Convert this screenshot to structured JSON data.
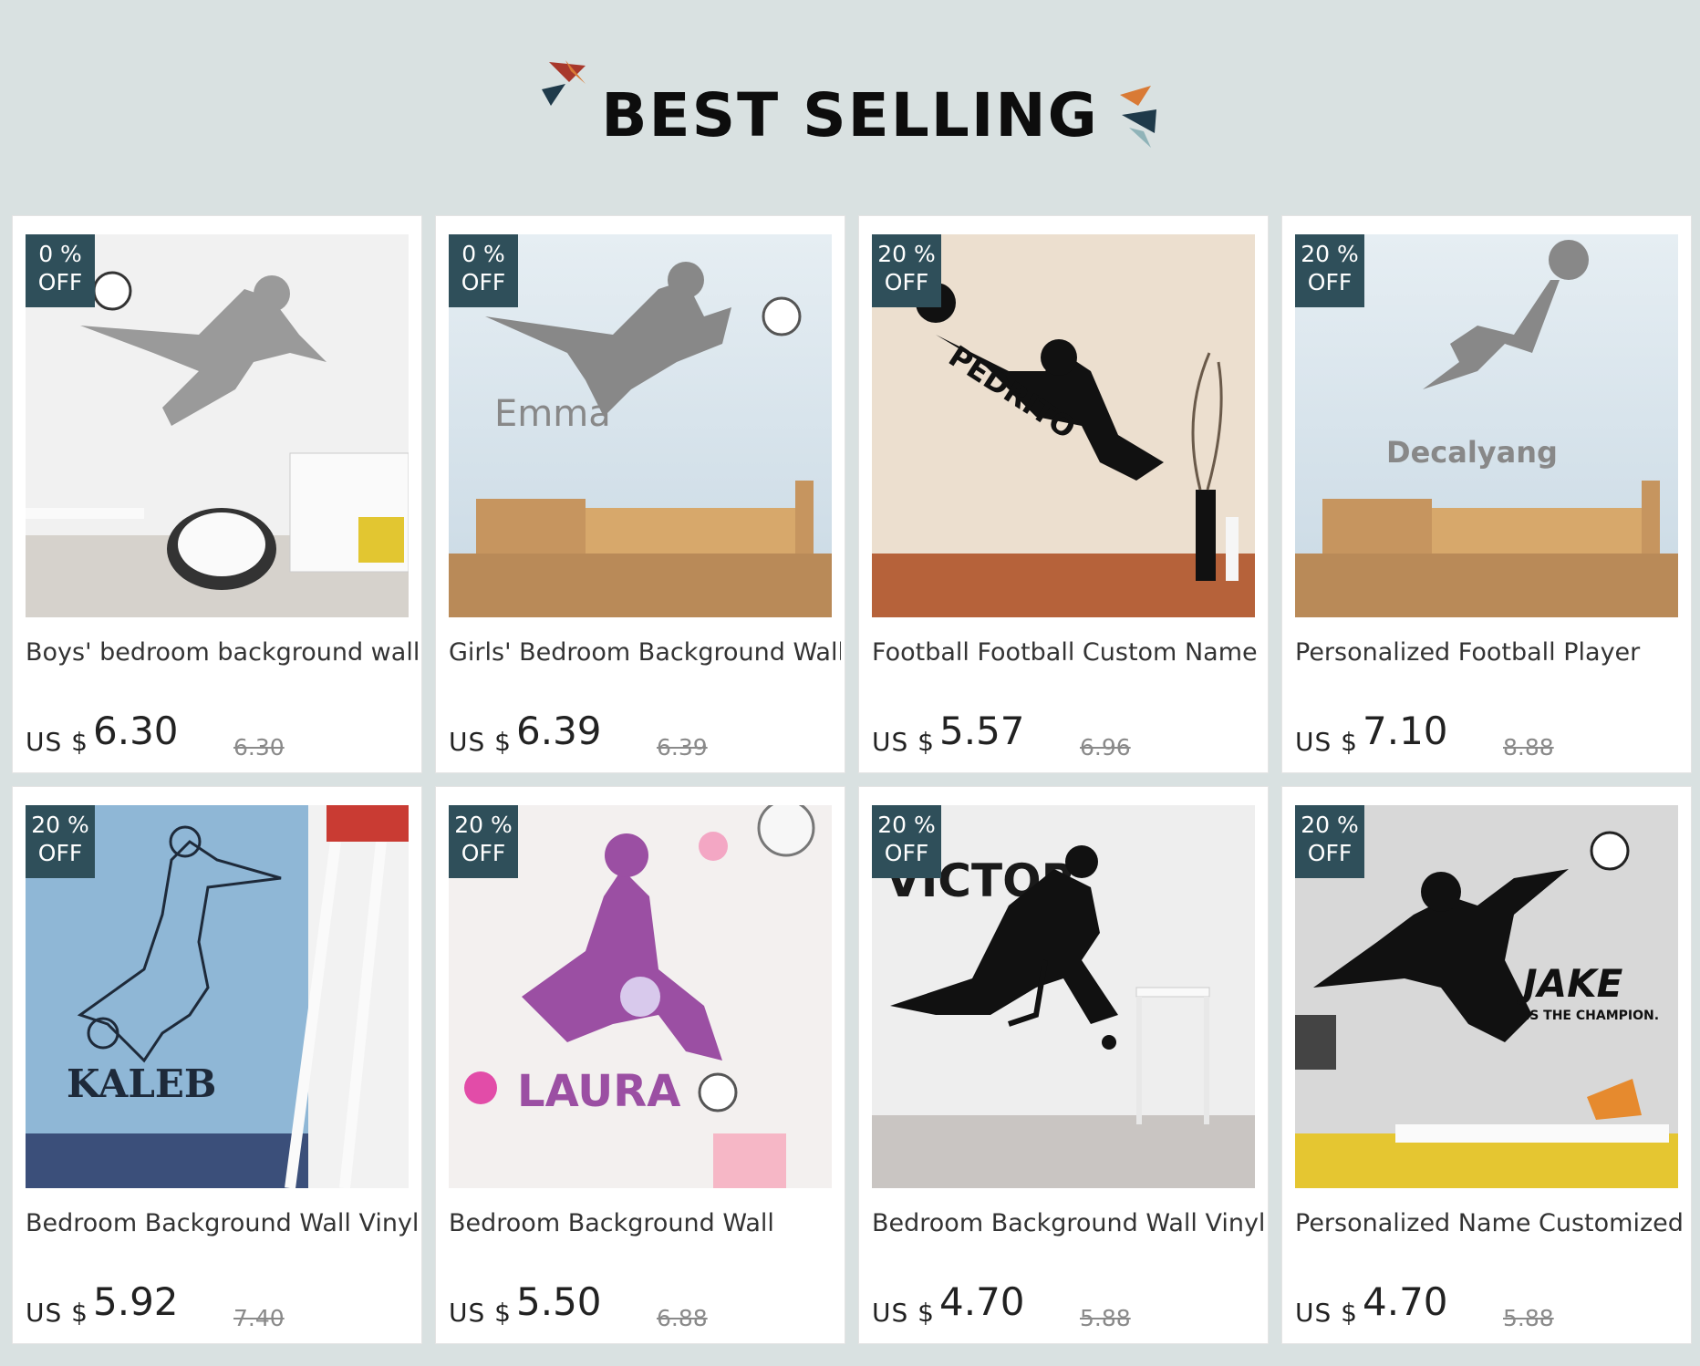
{
  "header": {
    "title": "BEST SELLING"
  },
  "colors": {
    "background": "#d9e1e1",
    "badge": "#2f4f5a",
    "deco_orange": "#d97a35",
    "deco_navy": "#1f3a4a",
    "deco_red": "#a8382b"
  },
  "products": [
    {
      "badge_pct": "0 %",
      "badge_off": "OFF",
      "title": "Boys' bedroom background wall",
      "currency": "US $",
      "price": "6.30",
      "old_price": "6.30",
      "wall_text": "",
      "image": "grey-football-player-kick-icon"
    },
    {
      "badge_pct": "0 %",
      "badge_off": "OFF",
      "title": "Girls' Bedroom Background Wall",
      "currency": "US $",
      "price": "6.39",
      "old_price": "6.39",
      "wall_text": "Emma",
      "image": "grey-goalkeeper-girl-icon"
    },
    {
      "badge_pct": "20 %",
      "badge_off": "OFF",
      "title": "Football Football Custom Name",
      "currency": "US $",
      "price": "5.57",
      "old_price": "6.96",
      "wall_text": "PEDRITO",
      "image": "black-goalkeeper-dive-icon"
    },
    {
      "badge_pct": "20 %",
      "badge_off": "OFF",
      "title": "Personalized Football Player",
      "currency": "US $",
      "price": "7.10",
      "old_price": "8.88",
      "wall_text": "Decalyang",
      "image": "grey-bicycle-kick-icon"
    },
    {
      "badge_pct": "20 %",
      "badge_off": "OFF",
      "title": "Bedroom Background Wall Vinyl",
      "currency": "US $",
      "price": "5.92",
      "old_price": "7.40",
      "wall_text": "KALEB",
      "image": "sketch-football-player-icon"
    },
    {
      "badge_pct": "20 %",
      "badge_off": "OFF",
      "title": "Bedroom Background Wall",
      "currency": "US $",
      "price": "5.50",
      "old_price": "6.88",
      "wall_text": "LAURA",
      "image": "purple-girl-football-icon"
    },
    {
      "badge_pct": "20 %",
      "badge_off": "OFF",
      "title": "Bedroom Background Wall Vinyl",
      "currency": "US $",
      "price": "4.70",
      "old_price": "5.88",
      "wall_text": "VICTOR",
      "image": "hockey-player-icon"
    },
    {
      "badge_pct": "20 %",
      "badge_off": "OFF",
      "title": "Personalized Name Customized",
      "currency": "US $",
      "price": "4.70",
      "old_price": "5.88",
      "wall_text": "JAKE",
      "wall_subtext": "IS THE CHAMPION.",
      "image": "black-volley-kick-icon"
    }
  ]
}
